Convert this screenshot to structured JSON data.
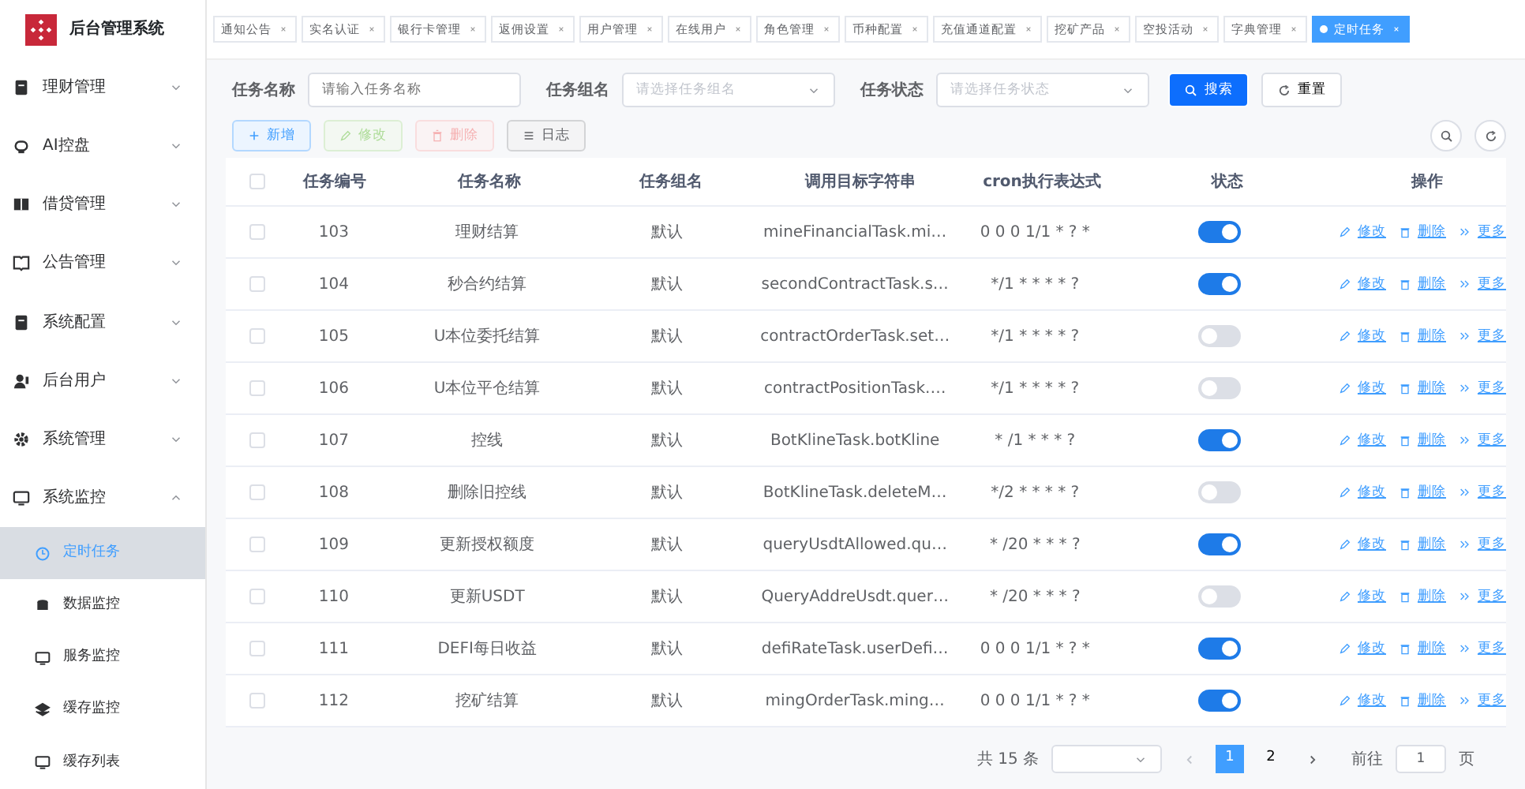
{
  "logo": {
    "title": "后台管理系统"
  },
  "sidebar": {
    "items": [
      {
        "label": "理财管理",
        "expanded": false
      },
      {
        "label": "AI控盘",
        "expanded": false
      },
      {
        "label": "借贷管理",
        "expanded": false
      },
      {
        "label": "公告管理",
        "expanded": false
      },
      {
        "label": "系统配置",
        "expanded": false
      },
      {
        "label": "后台用户",
        "expanded": false
      },
      {
        "label": "系统管理",
        "expanded": false
      },
      {
        "label": "系统监控",
        "expanded": true,
        "children": [
          {
            "label": "定时任务",
            "selected": true
          },
          {
            "label": "数据监控",
            "selected": false
          },
          {
            "label": "服务监控",
            "selected": false
          },
          {
            "label": "缓存监控",
            "selected": false
          },
          {
            "label": "缓存列表",
            "selected": false
          }
        ]
      }
    ]
  },
  "tabs": [
    {
      "label": "通知公告",
      "selected": false
    },
    {
      "label": "实名认证",
      "selected": false
    },
    {
      "label": "银行卡管理",
      "selected": false
    },
    {
      "label": "返佣设置",
      "selected": false
    },
    {
      "label": "用户管理",
      "selected": false
    },
    {
      "label": "在线用户",
      "selected": false
    },
    {
      "label": "角色管理",
      "selected": false
    },
    {
      "label": "币种配置",
      "selected": false
    },
    {
      "label": "充值通道配置",
      "selected": false
    },
    {
      "label": "挖矿产品",
      "selected": false
    },
    {
      "label": "空投活动",
      "selected": false
    },
    {
      "label": "字典管理",
      "selected": false
    },
    {
      "label": "定时任务",
      "selected": true
    }
  ],
  "search_form": {
    "fields": [
      {
        "label": "任务名称",
        "placeholder": "请输入任务名称",
        "kind": "input"
      },
      {
        "label": "任务组名",
        "placeholder": "请选择任务组名",
        "kind": "select"
      },
      {
        "label": "任务状态",
        "placeholder": "请选择任务状态",
        "kind": "select"
      }
    ],
    "search_button": "搜索",
    "reset_button": "重置"
  },
  "toolbar": [
    {
      "label": "新增",
      "kind": "add",
      "disabled": false
    },
    {
      "label": "修改",
      "kind": "edit",
      "disabled": true
    },
    {
      "label": "删除",
      "kind": "delete",
      "disabled": true
    },
    {
      "label": "日志",
      "kind": "log",
      "disabled": false
    }
  ],
  "table": {
    "columns": [
      "任务编号",
      "任务名称",
      "任务组名",
      "调用目标字符串",
      "cron执行表达式",
      "状态",
      "操作"
    ],
    "select_all_checked": false,
    "rows": [
      {
        "id": "103",
        "name": "理财结算",
        "group": "默认",
        "target": "mineFinancialTask.mi…",
        "cron": "0 0 0 1/1 * ? *",
        "enabled": true,
        "checked": false,
        "actions": [
          "修改",
          "删除",
          "更多"
        ]
      },
      {
        "id": "104",
        "name": "秒合约结算",
        "group": "默认",
        "target": "secondContractTask.s…",
        "cron": "*/1 * * * * ?",
        "enabled": true,
        "checked": false,
        "actions": [
          "修改",
          "删除",
          "更多"
        ]
      },
      {
        "id": "105",
        "name": "U本位委托结算",
        "group": "默认",
        "target": "contractOrderTask.set…",
        "cron": "*/1 * * * * ?",
        "enabled": false,
        "checked": false,
        "actions": [
          "修改",
          "删除",
          "更多"
        ]
      },
      {
        "id": "106",
        "name": "U本位平仓结算",
        "group": "默认",
        "target": "contractPositionTask.…",
        "cron": "*/1 * * * * ?",
        "enabled": false,
        "checked": false,
        "actions": [
          "修改",
          "删除",
          "更多"
        ]
      },
      {
        "id": "107",
        "name": "控线",
        "group": "默认",
        "target": "BotKlineTask.botKline",
        "cron": "* /1 * * * ?",
        "enabled": true,
        "checked": false,
        "actions": [
          "修改",
          "删除",
          "更多"
        ]
      },
      {
        "id": "108",
        "name": "删除旧控线",
        "group": "默认",
        "target": "BotKlineTask.deleteM…",
        "cron": "*/2 * * * * ?",
        "enabled": false,
        "checked": false,
        "actions": [
          "修改",
          "删除",
          "更多"
        ]
      },
      {
        "id": "109",
        "name": "更新授权额度",
        "group": "默认",
        "target": "queryUsdtAllowed.qu…",
        "cron": "* /20 * * * ?",
        "enabled": true,
        "checked": false,
        "actions": [
          "修改",
          "删除",
          "更多"
        ]
      },
      {
        "id": "110",
        "name": "更新USDT",
        "group": "默认",
        "target": "QueryAddreUsdt.quer…",
        "cron": "* /20 * * * ?",
        "enabled": false,
        "checked": false,
        "actions": [
          "修改",
          "删除",
          "更多"
        ]
      },
      {
        "id": "111",
        "name": "DEFI每日收益",
        "group": "默认",
        "target": "defiRateTask.userDefi…",
        "cron": "0 0 0 1/1 * ? *",
        "enabled": true,
        "checked": false,
        "actions": [
          "修改",
          "删除",
          "更多"
        ]
      },
      {
        "id": "112",
        "name": "挖矿结算",
        "group": "默认",
        "target": "mingOrderTask.ming…",
        "cron": "0 0 0 1/1 * ? *",
        "enabled": true,
        "checked": false,
        "actions": [
          "修改",
          "删除",
          "更多"
        ]
      }
    ]
  },
  "pagination": {
    "total": "共 15 条",
    "pages": [
      {
        "label": "1",
        "selected": true
      },
      {
        "label": "2",
        "selected": false
      }
    ],
    "goto_label": "前往",
    "goto_value": "1",
    "page_unit": "页"
  }
}
